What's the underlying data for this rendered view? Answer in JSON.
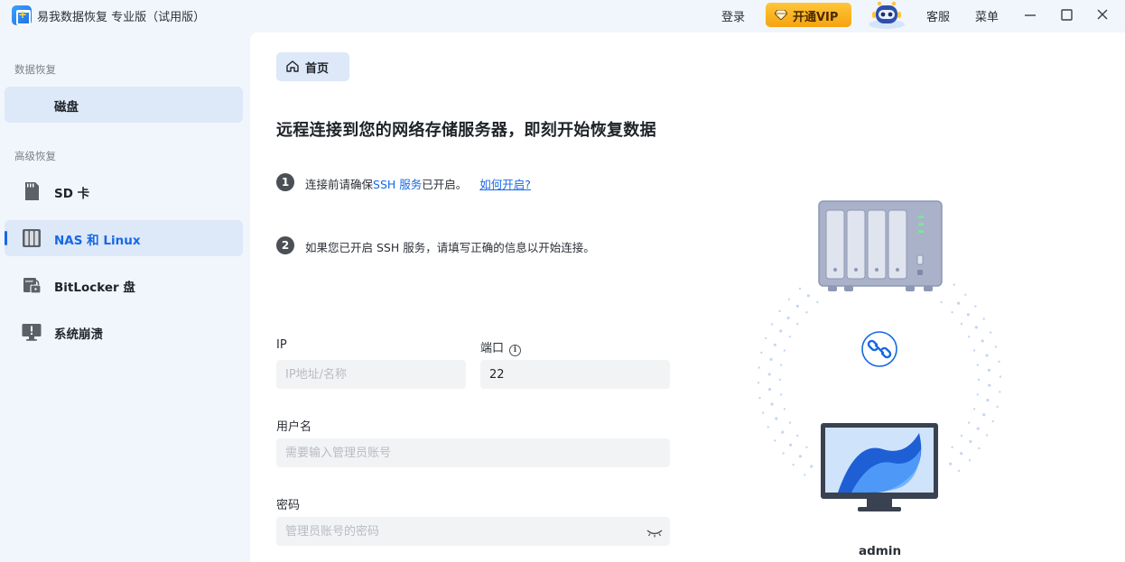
{
  "app": {
    "title": "易我数据恢复 专业版（试用版）"
  },
  "titlebar": {
    "login_label": "登录",
    "vip_label": "开通VIP",
    "support_label": "客服",
    "menu_label": "菜单"
  },
  "sidebar": {
    "section_data_recovery": "数据恢复",
    "section_advanced": "高级恢复",
    "items": [
      {
        "label": "磁盘",
        "icon": "disk-icon"
      },
      {
        "label": "SD 卡",
        "icon": "sd-card-icon"
      },
      {
        "label": "NAS 和 Linux",
        "icon": "nas-icon"
      },
      {
        "label": "BitLocker 盘",
        "icon": "bitlocker-icon"
      },
      {
        "label": "系统崩溃",
        "icon": "system-crash-icon"
      }
    ],
    "selected": "NAS 和 Linux"
  },
  "main": {
    "home_tab_label": "首页",
    "headline": "远程连接到您的网络存储服务器，即刻开始恢复数据",
    "step1": {
      "number": "1",
      "prefix": "连接前请确保",
      "highlight": "SSH 服务",
      "suffix": "已开启。",
      "link": "如何开启?"
    },
    "step2": {
      "number": "2",
      "text": "如果您已开启 SSH 服务，请填写正确的信息以开始连接。"
    }
  },
  "form": {
    "ip_label": "IP",
    "ip_placeholder": "IP地址/名称",
    "ip_value": "",
    "port_label": "端口",
    "port_value": "22",
    "username_label": "用户名",
    "username_placeholder": "需要输入管理员账号",
    "password_label": "密码",
    "password_placeholder": "管理员账号的密码"
  },
  "illustration": {
    "device_label": "admin"
  },
  "colors": {
    "accent": "#1768e4",
    "sidebar_bg": "#f1f6fd",
    "vip": "#f5a410"
  }
}
